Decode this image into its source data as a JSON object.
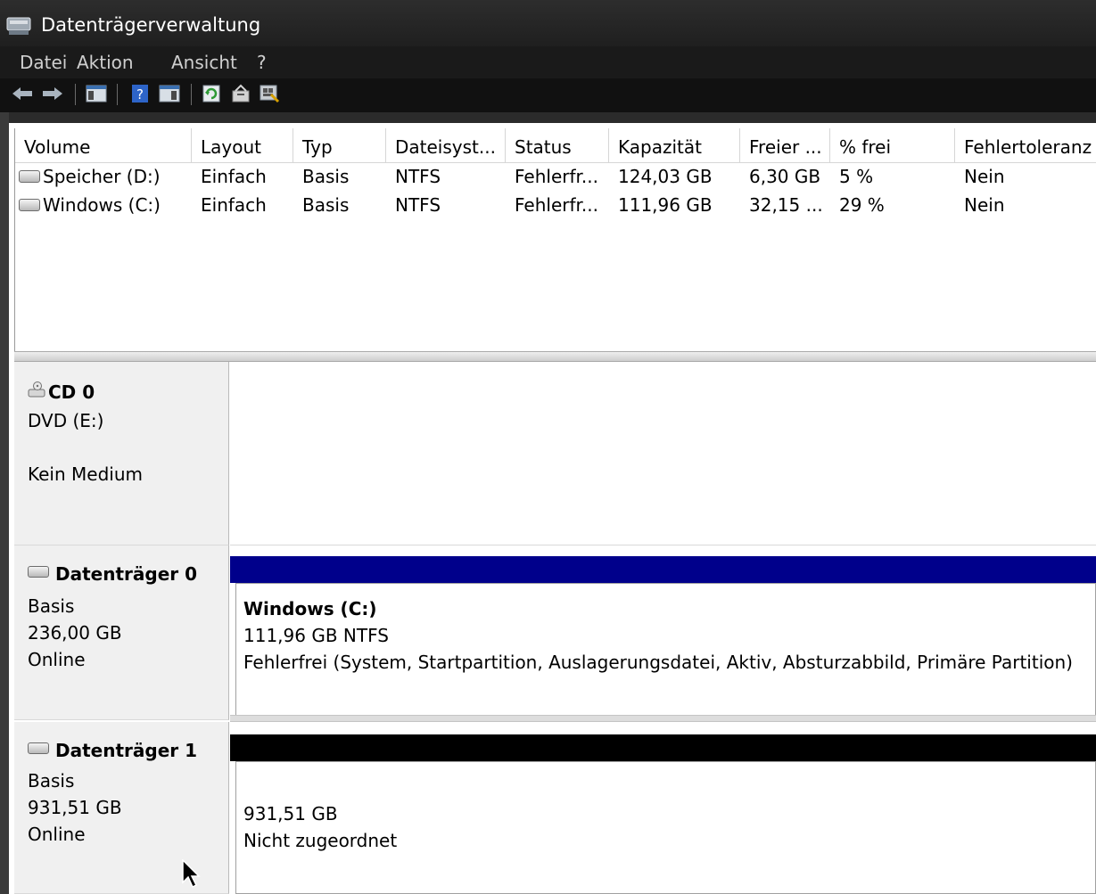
{
  "window": {
    "title": "Datenträgerverwaltung"
  },
  "menu": {
    "items": [
      "Datei",
      "Aktion",
      "Ansicht",
      "?"
    ]
  },
  "toolbar": {
    "icons": [
      "back-arrow-icon",
      "forward-arrow-icon",
      "console-tree-icon",
      "help-icon",
      "action-pane-icon",
      "refresh-icon",
      "properties-icon",
      "rescan-icon"
    ]
  },
  "volume_list": {
    "columns": [
      "Volume",
      "Layout",
      "Typ",
      "Dateisyst...",
      "Status",
      "Kapazität",
      "Freier ...",
      "% frei",
      "Fehlertoleranz"
    ],
    "rows": [
      {
        "volume": "Speicher (D:)",
        "layout": "Einfach",
        "typ": "Basis",
        "dateisystem": "NTFS",
        "status": "Fehlerfr...",
        "kapazitaet": "124,03 GB",
        "freier": "6,30 GB",
        "frei_pct": "5 %",
        "fehlertoleranz": "Nein"
      },
      {
        "volume": "Windows (C:)",
        "layout": "Einfach",
        "typ": "Basis",
        "dateisystem": "NTFS",
        "status": "Fehlerfr...",
        "kapazitaet": "111,96 GB",
        "freier": "32,15 ...",
        "frei_pct": "29 %",
        "fehlertoleranz": "Nein"
      }
    ]
  },
  "disks": {
    "cd0": {
      "name": "CD 0",
      "line1": "DVD (E:)",
      "line2": "Kein Medium"
    },
    "disk0": {
      "name": "Datenträger 0",
      "type": "Basis",
      "size": "236,00 GB",
      "state": "Online",
      "bar_color": "#00008b",
      "volume": {
        "name": "Windows  (C:)",
        "size_fs": "111,96 GB NTFS",
        "status": "Fehlerfrei (System, Startpartition, Auslagerungsdatei, Aktiv, Absturzabbild, Primäre Partition)"
      }
    },
    "disk1": {
      "name": "Datenträger 1",
      "type": "Basis",
      "size": "931,51 GB",
      "state": "Online",
      "bar_color": "#000000",
      "volume": {
        "size": "931,51 GB",
        "status": "Nicht zugeordnet"
      }
    }
  }
}
